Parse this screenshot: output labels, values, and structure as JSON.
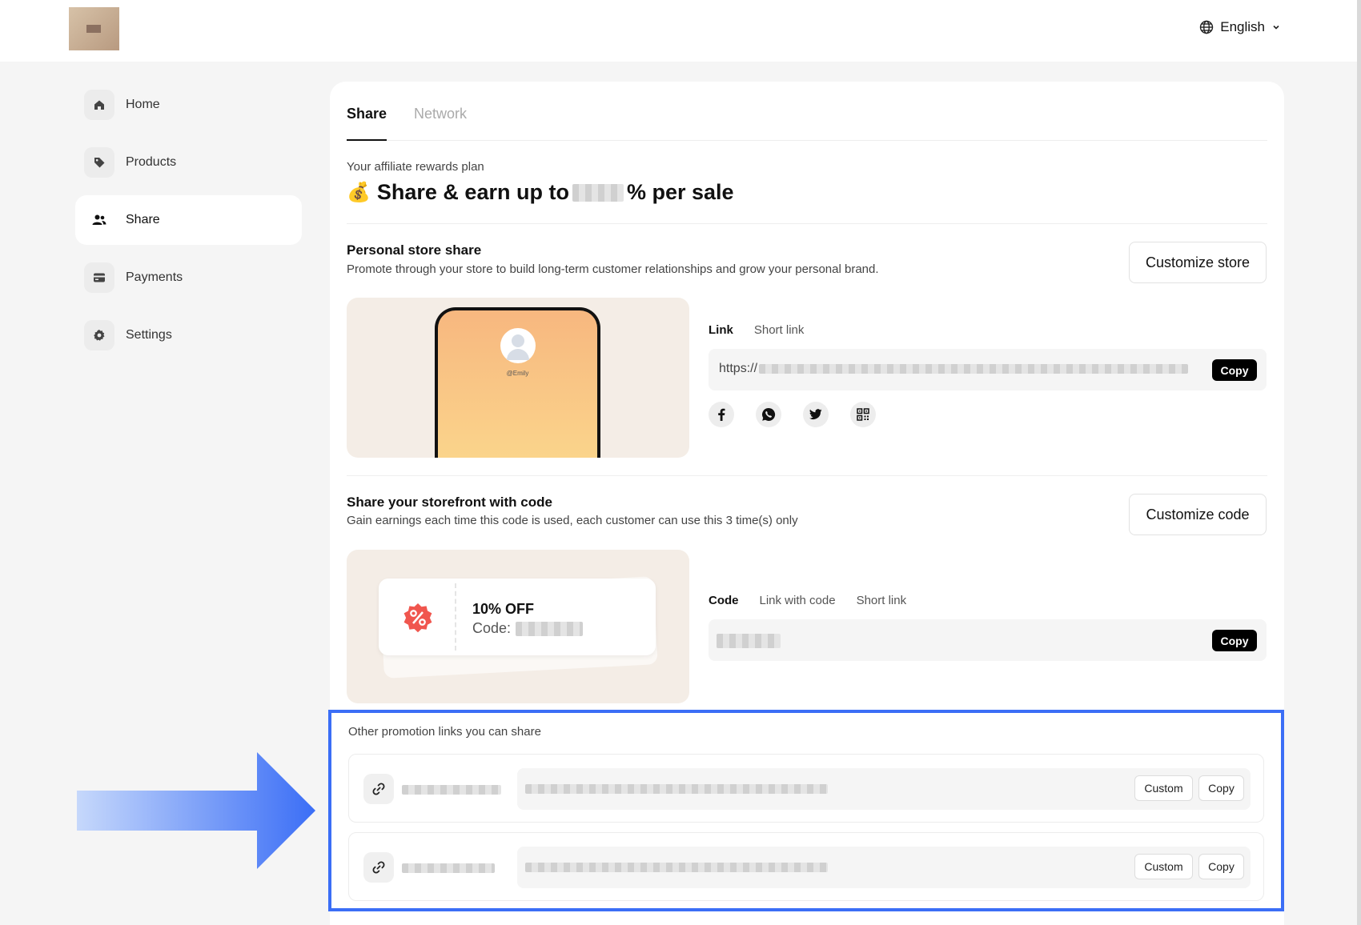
{
  "header": {
    "language": "English"
  },
  "sidebar": {
    "items": [
      {
        "label": "Home",
        "icon": "home-icon"
      },
      {
        "label": "Products",
        "icon": "tag-icon"
      },
      {
        "label": "Share",
        "icon": "users-icon",
        "active": true
      },
      {
        "label": "Payments",
        "icon": "card-icon"
      },
      {
        "label": "Settings",
        "icon": "gear-icon"
      }
    ]
  },
  "tabs": {
    "share": "Share",
    "network": "Network"
  },
  "plan": {
    "label": "Your affiliate rewards plan",
    "title_prefix": "Share & earn up to",
    "title_suffix": "% per sale",
    "emoji": "💰"
  },
  "personal_store": {
    "title": "Personal store share",
    "description": "Promote through your store to build long-term customer relationships and grow your personal brand.",
    "button": "Customize store",
    "preview_username": "@Emily",
    "subtabs": [
      "Link",
      "Short link"
    ],
    "url_prefix": "https://",
    "copy_label": "Copy"
  },
  "storefront_code": {
    "title": "Share your storefront with code",
    "description": "Gain earnings each time this code is used, each customer can use this 3 time(s) only",
    "button": "Customize code",
    "coupon_off": "10% OFF",
    "coupon_code_label": "Code:",
    "subtabs": [
      "Code",
      "Link with code",
      "Short link"
    ],
    "copy_label": "Copy"
  },
  "promotions": {
    "label": "Other promotion links you can share",
    "rows": [
      {
        "custom_label": "Custom",
        "copy_label": "Copy"
      },
      {
        "custom_label": "Custom",
        "copy_label": "Copy"
      }
    ]
  },
  "colors": {
    "accent": "#3b6ef6",
    "arrow_start": "#c6d8fb",
    "arrow_end": "#3b6ef6"
  }
}
